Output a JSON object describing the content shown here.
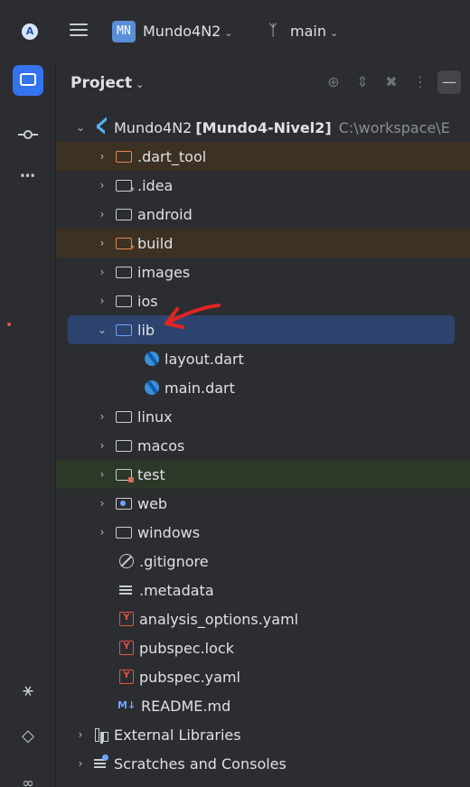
{
  "topbar": {
    "app_logo": "A",
    "project_badge": "MN",
    "project_name": "Mundo4N2",
    "branch_name": "main"
  },
  "panel": {
    "title": "Project"
  },
  "tree": {
    "root": {
      "name": "Mundo4N2",
      "module": "[Mundo4-Nivel2]",
      "path": "C:\\workspace\\E"
    },
    "items": [
      {
        "label": ".dart_tool"
      },
      {
        "label": ".idea"
      },
      {
        "label": "android"
      },
      {
        "label": "build"
      },
      {
        "label": "images"
      },
      {
        "label": "ios"
      },
      {
        "label": "lib"
      },
      {
        "label": "layout.dart"
      },
      {
        "label": "main.dart"
      },
      {
        "label": "linux"
      },
      {
        "label": "macos"
      },
      {
        "label": "test"
      },
      {
        "label": "web"
      },
      {
        "label": "windows"
      },
      {
        "label": ".gitignore"
      },
      {
        "label": ".metadata"
      },
      {
        "label": "analysis_options.yaml"
      },
      {
        "label": "pubspec.lock"
      },
      {
        "label": "pubspec.yaml"
      },
      {
        "label": "README.md"
      },
      {
        "label": "External Libraries"
      },
      {
        "label": "Scratches and Consoles"
      }
    ]
  },
  "icons": {
    "yaml_letter": "Y",
    "markdown_badge": "M↓"
  },
  "colors": {
    "accent": "#3574f0",
    "selection": "#2e436e",
    "excluded_bg": "#3d3124",
    "test_bg": "#2c3828",
    "annotation_arrow": "#e02424"
  }
}
